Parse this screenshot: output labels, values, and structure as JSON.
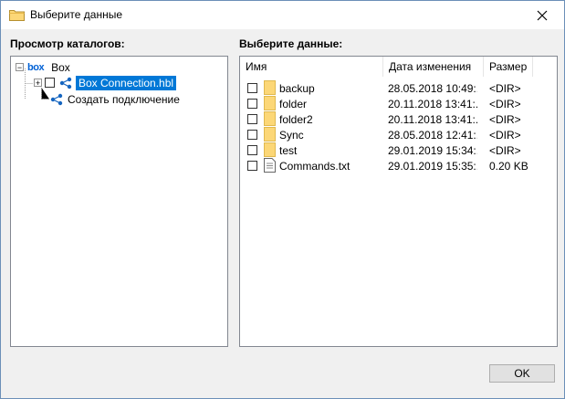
{
  "window": {
    "title": "Выберите данные",
    "close_icon": "close-icon"
  },
  "left_panel": {
    "label": "Просмотр каталогов:",
    "tree": {
      "root": {
        "logo": "box",
        "label": "Box"
      },
      "connection": {
        "label": "Box Connection.hbl",
        "selected": true
      },
      "create": {
        "label": "Создать подключение"
      }
    }
  },
  "right_panel": {
    "label": "Выберите данные:",
    "columns": {
      "name": "Имя",
      "modified": "Дата изменения",
      "size": "Размер"
    },
    "rows": [
      {
        "name": "backup",
        "modified": "28.05.2018 10:49:...",
        "size": "<DIR>",
        "icon": "folder-icon"
      },
      {
        "name": "folder",
        "modified": "20.11.2018 13:41:...",
        "size": "<DIR>",
        "icon": "folder-icon"
      },
      {
        "name": "folder2",
        "modified": "20.11.2018 13:41:...",
        "size": "<DIR>",
        "icon": "folder-icon"
      },
      {
        "name": "Sync",
        "modified": "28.05.2018 12:41:...",
        "size": "<DIR>",
        "icon": "folder-icon"
      },
      {
        "name": "test",
        "modified": "29.01.2019 15:34:...",
        "size": "<DIR>",
        "icon": "folder-icon"
      },
      {
        "name": "Commands.txt",
        "modified": "29.01.2019 15:35:...",
        "size": "0.20 KB",
        "icon": "text-file-icon"
      }
    ]
  },
  "buttons": {
    "ok": "OK"
  },
  "colors": {
    "selection": "#0078d7",
    "folder": "#fcd777",
    "border": "#828790"
  }
}
